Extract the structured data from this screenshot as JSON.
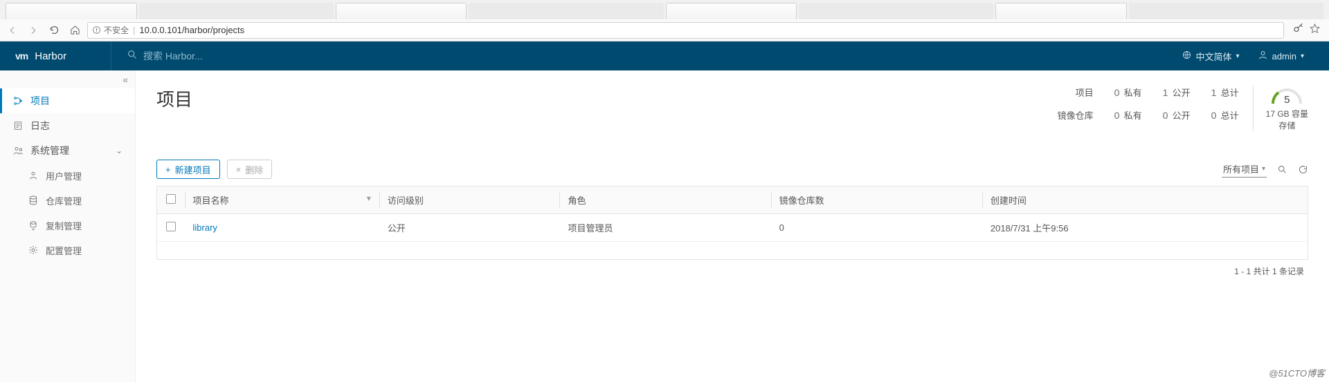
{
  "browser": {
    "insecure_label": "不安全",
    "url": "10.0.0.101/harbor/projects"
  },
  "header": {
    "product": "Harbor",
    "logo_text": "vm",
    "search_placeholder": "搜索 Harbor...",
    "language": "中文简体",
    "user": "admin"
  },
  "sidebar": {
    "items": [
      {
        "label": "项目"
      },
      {
        "label": "日志"
      },
      {
        "label": "系统管理"
      },
      {
        "label": "用户管理"
      },
      {
        "label": "仓库管理"
      },
      {
        "label": "复制管理"
      },
      {
        "label": "配置管理"
      }
    ]
  },
  "page": {
    "title": "项目"
  },
  "stats": {
    "row1_label": "项目",
    "row2_label": "镜像仓库",
    "private_label": "私有",
    "public_label": "公开",
    "total_label": "总计",
    "project_private": "0",
    "project_public": "1",
    "project_total": "1",
    "repo_private": "0",
    "repo_public": "0",
    "repo_total": "0",
    "storage_used": "5",
    "storage_line1": "17 GB 容量",
    "storage_line2": "存储"
  },
  "toolbar": {
    "new_project": "新建项目",
    "delete": "删除",
    "filter_label": "所有项目"
  },
  "table": {
    "headers": {
      "name": "项目名称",
      "access": "访问级别",
      "role": "角色",
      "repo_count": "镜像仓库数",
      "created": "创建时间"
    },
    "rows": [
      {
        "name": "library",
        "access": "公开",
        "role": "项目管理员",
        "repo_count": "0",
        "created": "2018/7/31 上午9:56"
      }
    ],
    "pager": "1 - 1 共计 1 条记录"
  },
  "watermark": "@51CTO博客"
}
